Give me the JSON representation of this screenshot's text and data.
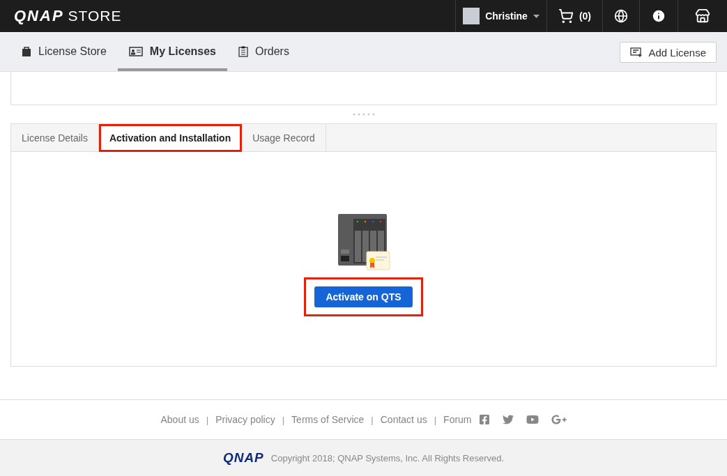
{
  "header": {
    "logo": "QNAP",
    "logo_suffix": "STORE",
    "user": {
      "name": "Christine"
    },
    "cart": {
      "count": "(0)"
    }
  },
  "nav": {
    "tabs": [
      {
        "label": "License Store",
        "selected": false
      },
      {
        "label": "My Licenses",
        "selected": true
      },
      {
        "label": "Orders",
        "selected": false
      }
    ],
    "add_button": "Add License"
  },
  "detail_tabs": [
    {
      "label": "License Details",
      "selected": false,
      "highlighted": false
    },
    {
      "label": "Activation and Installation",
      "selected": true,
      "highlighted": true
    },
    {
      "label": "Usage Record",
      "selected": false,
      "highlighted": false
    }
  ],
  "activate_button": {
    "label": "Activate on QTS",
    "highlighted": true
  },
  "footer": {
    "items": [
      {
        "kind": "link",
        "text": "About us"
      },
      {
        "kind": "separator",
        "text": "|"
      },
      {
        "kind": "link",
        "text": "Privacy policy"
      },
      {
        "kind": "separator",
        "text": "|"
      },
      {
        "kind": "link",
        "text": "Terms of Service"
      },
      {
        "kind": "separator",
        "text": "|"
      },
      {
        "kind": "link",
        "text": "Contact us"
      },
      {
        "kind": "separator",
        "text": "|"
      },
      {
        "kind": "link",
        "text": "Forum"
      }
    ],
    "logo": "QNAP",
    "copyright": "Copyright 2018; QNAP Systems, Inc. All Rights Reserved."
  }
}
